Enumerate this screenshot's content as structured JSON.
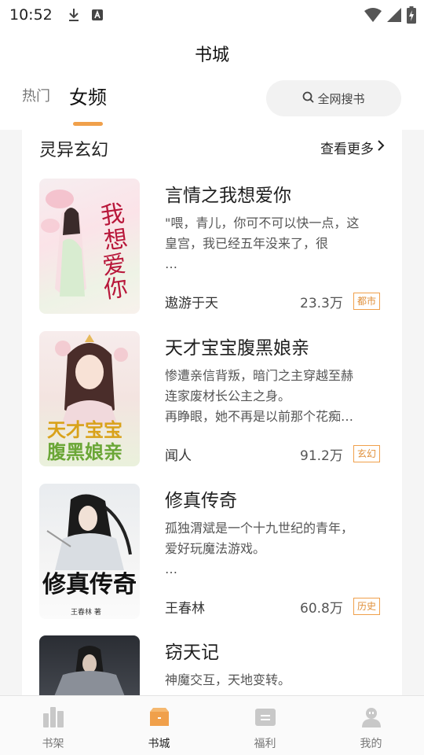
{
  "status_bar": {
    "time": "10:52"
  },
  "header": {
    "title": "书城"
  },
  "tabs": [
    {
      "label": "热门",
      "active": false
    },
    {
      "label": "女频",
      "active": true
    }
  ],
  "search": {
    "label": "全网搜书"
  },
  "section": {
    "title": "灵异玄幻",
    "more_label": "查看更多"
  },
  "books": [
    {
      "title": "言情之我想爱你",
      "desc_lines": [
        "\"喂，青儿，你可不可以快一点，这",
        "皇宫，我已经五年没来了，很",
        "…"
      ],
      "author": "遨游于天",
      "count": "23.3万",
      "tag": "都市",
      "cover_text": "我想爱你"
    },
    {
      "title": "天才宝宝腹黑娘亲",
      "desc_lines": [
        "惨遭亲信背叛，暗门之主穿越至赫",
        "连家废材长公主之身。",
        "再睁眼，她不再是以前那个花痴…"
      ],
      "author": "闻人",
      "count": "91.2万",
      "tag": "玄幻",
      "cover_text": "天才宝宝腹黑娘亲"
    },
    {
      "title": "修真传奇",
      "desc_lines": [
        "孤独渭斌是一个十九世纪的青年，",
        "爱好玩魔法游戏。",
        "…"
      ],
      "author": "王春林",
      "count": "60.8万",
      "tag": "历史",
      "cover_text": "修真传奇"
    },
    {
      "title": "窃天记",
      "desc_lines": [
        "神魔交互，天地变转。"
      ],
      "author": "",
      "count": "",
      "tag": "",
      "cover_text": ""
    }
  ],
  "bottom_nav": [
    {
      "label": "书架",
      "icon": "bookshelf-icon",
      "active": false
    },
    {
      "label": "书城",
      "icon": "bookstore-icon",
      "active": true
    },
    {
      "label": "福利",
      "icon": "welfare-icon",
      "active": false
    },
    {
      "label": "我的",
      "icon": "profile-icon",
      "active": false
    }
  ],
  "colors": {
    "accent": "#f0a04b",
    "nav_inactive": "#c8c8c8"
  }
}
